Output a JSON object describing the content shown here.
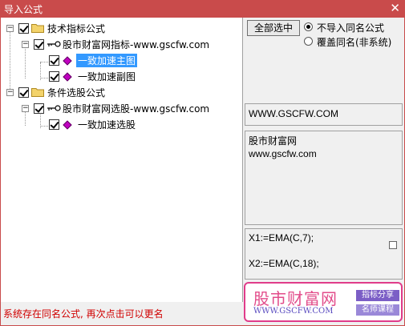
{
  "window": {
    "title": "导入公式",
    "close_glyph": "✕"
  },
  "tree": {
    "groups": [
      {
        "label": "技术指标公式",
        "expand": "−",
        "child": {
          "label": "股市财富网指标-www.gscfw.com",
          "expand": "−",
          "items": [
            {
              "label": "一致加速主图",
              "selected": true
            },
            {
              "label": "一致加速副图",
              "selected": false
            }
          ]
        }
      },
      {
        "label": "条件选股公式",
        "expand": "−",
        "child": {
          "label": "股市财富网选股-www.gscfw.com",
          "expand": "−",
          "items": [
            {
              "label": "一致加速选股",
              "selected": false
            }
          ]
        }
      }
    ]
  },
  "options": {
    "select_all_label": "全部选中",
    "radio1_label": "不导入同名公式",
    "radio2_label": "覆盖同名(非系统)"
  },
  "info": {
    "url": "WWW.GSCFW.COM",
    "desc_line1": "股市财富网",
    "desc_line2": "www.gscfw.com",
    "code_line1": "X1:=EMA(C,7);",
    "code_line2": "X2:=EMA(C,18);"
  },
  "status": {
    "message": "系统存在同名公式, 再次点击可以更名"
  },
  "watermark": {
    "brand": "股市财富网",
    "url": "WWW.GSCFW.COM",
    "tag1": "指标分享",
    "tag2": "名师课程"
  },
  "colors": {
    "titlebar": "#c94b4b",
    "selection": "#3399ff",
    "status_text": "#d00000",
    "watermark_border": "#e03c8a",
    "watermark_brand": "#e24c8a",
    "watermark_url": "#5a4cc0"
  }
}
